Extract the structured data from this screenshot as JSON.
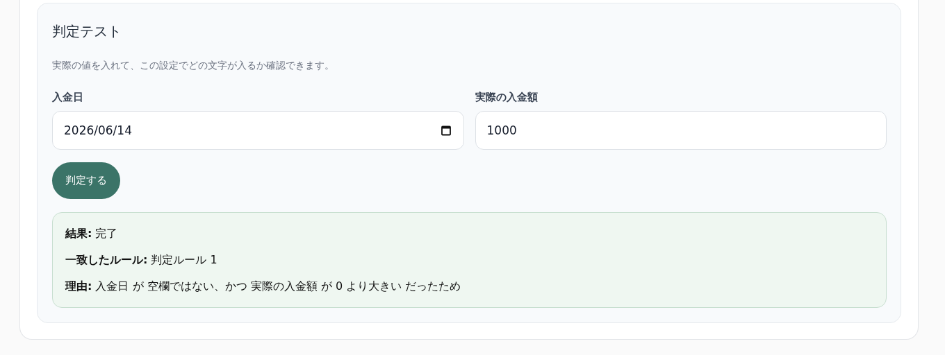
{
  "section": {
    "title": "判定テスト",
    "description": "実際の値を入れて、この設定でどの文字が入るか確認できます。"
  },
  "fields": [
    {
      "kind": "date",
      "label": "入金日",
      "value": "2026/06/14"
    },
    {
      "kind": "number",
      "label": "実際の入金額",
      "value": "1000"
    }
  ],
  "button": "判定する",
  "result": [
    "**結果:** 完了",
    "**一致したルール:** 判定ルール 1",
    "**理由:** 入金日 が 空欄ではない、かつ 実際の入金額 が 0 より大きい だったため"
  ]
}
